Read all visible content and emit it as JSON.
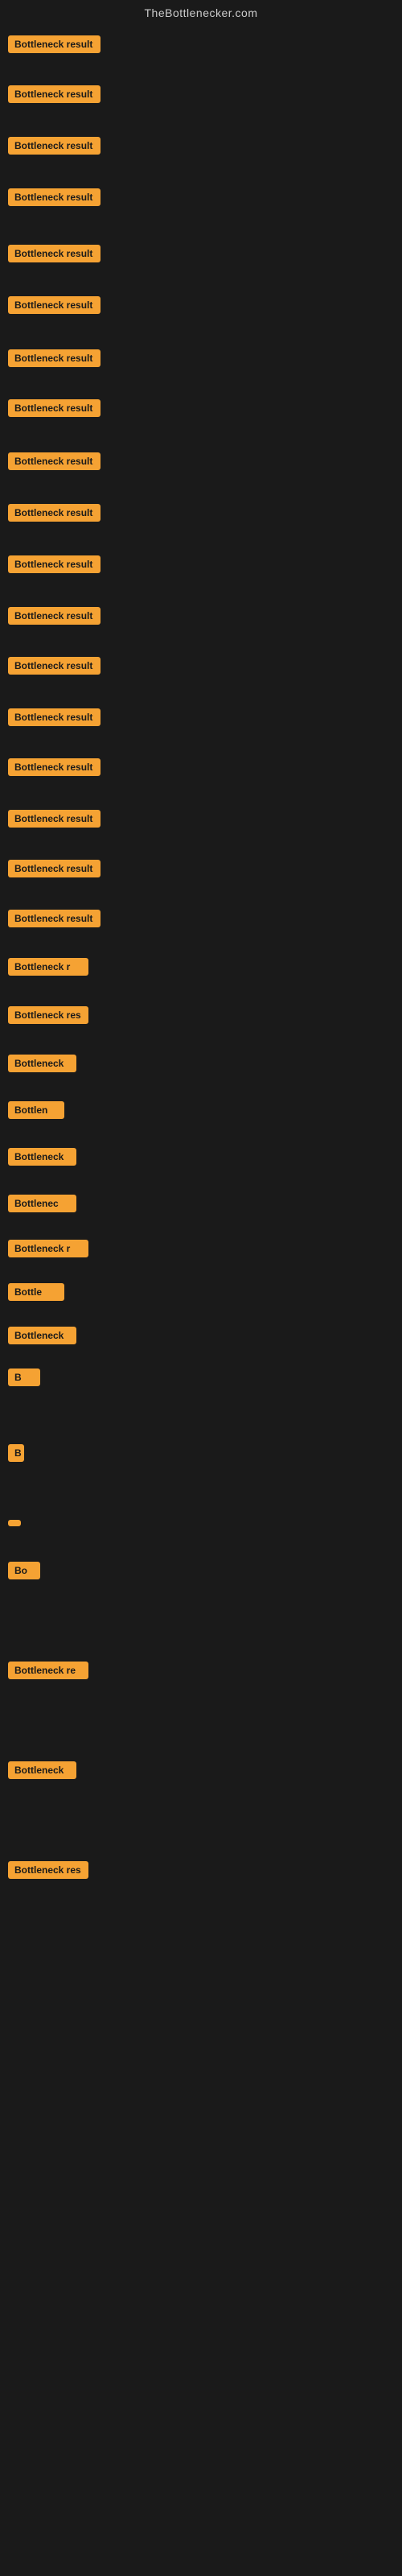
{
  "header": {
    "title": "TheBottlenecker.com"
  },
  "rows": [
    {
      "id": 1,
      "label": "Bottleneck result",
      "rowClass": "row-1",
      "badgeClass": "w-full"
    },
    {
      "id": 2,
      "label": "Bottleneck result",
      "rowClass": "row-2",
      "badgeClass": "w-full"
    },
    {
      "id": 3,
      "label": "Bottleneck result",
      "rowClass": "row-3",
      "badgeClass": "w-full"
    },
    {
      "id": 4,
      "label": "Bottleneck result",
      "rowClass": "row-4",
      "badgeClass": "w-full"
    },
    {
      "id": 5,
      "label": "Bottleneck result",
      "rowClass": "row-5",
      "badgeClass": "w-full"
    },
    {
      "id": 6,
      "label": "Bottleneck result",
      "rowClass": "row-6",
      "badgeClass": "w-full"
    },
    {
      "id": 7,
      "label": "Bottleneck result",
      "rowClass": "row-7",
      "badgeClass": "w-full"
    },
    {
      "id": 8,
      "label": "Bottleneck result",
      "rowClass": "row-8",
      "badgeClass": "w-full"
    },
    {
      "id": 9,
      "label": "Bottleneck result",
      "rowClass": "row-9",
      "badgeClass": "w-full"
    },
    {
      "id": 10,
      "label": "Bottleneck result",
      "rowClass": "row-10",
      "badgeClass": "w-full"
    },
    {
      "id": 11,
      "label": "Bottleneck result",
      "rowClass": "row-11",
      "badgeClass": "w-full"
    },
    {
      "id": 12,
      "label": "Bottleneck result",
      "rowClass": "row-12",
      "badgeClass": "w-full"
    },
    {
      "id": 13,
      "label": "Bottleneck result",
      "rowClass": "row-13",
      "badgeClass": "w-full"
    },
    {
      "id": 14,
      "label": "Bottleneck result",
      "rowClass": "row-14",
      "badgeClass": "w-full"
    },
    {
      "id": 15,
      "label": "Bottleneck result",
      "rowClass": "row-15",
      "badgeClass": "w-full"
    },
    {
      "id": 16,
      "label": "Bottleneck result",
      "rowClass": "row-16",
      "badgeClass": "w-full"
    },
    {
      "id": 17,
      "label": "Bottleneck result",
      "rowClass": "row-17",
      "badgeClass": "w-full"
    },
    {
      "id": 18,
      "label": "Bottleneck result",
      "rowClass": "row-18",
      "badgeClass": "w-full"
    },
    {
      "id": 19,
      "label": "Bottleneck r",
      "rowClass": "row-19",
      "badgeClass": "w-lg"
    },
    {
      "id": 20,
      "label": "Bottleneck res",
      "rowClass": "row-20",
      "badgeClass": "w-lg"
    },
    {
      "id": 21,
      "label": "Bottleneck",
      "rowClass": "row-21",
      "badgeClass": "w-md"
    },
    {
      "id": 22,
      "label": "Bottlen",
      "rowClass": "row-22",
      "badgeClass": "w-sm"
    },
    {
      "id": 23,
      "label": "Bottleneck",
      "rowClass": "row-23",
      "badgeClass": "w-md"
    },
    {
      "id": 24,
      "label": "Bottlenec",
      "rowClass": "row-24",
      "badgeClass": "w-md"
    },
    {
      "id": 25,
      "label": "Bottleneck r",
      "rowClass": "row-25",
      "badgeClass": "w-lg"
    },
    {
      "id": 26,
      "label": "Bottle",
      "rowClass": "row-26",
      "badgeClass": "w-sm"
    },
    {
      "id": 27,
      "label": "Bottleneck",
      "rowClass": "row-27",
      "badgeClass": "w-md"
    },
    {
      "id": 28,
      "label": "B",
      "rowClass": "row-28",
      "badgeClass": "w-xxs"
    },
    {
      "id": 29,
      "label": "B",
      "rowClass": "row-29",
      "badgeClass": "w-tiny"
    },
    {
      "id": 30,
      "label": "",
      "rowClass": "row-30",
      "badgeClass": "w-min"
    },
    {
      "id": 31,
      "label": "Bo",
      "rowClass": "row-31",
      "badgeClass": "w-xxs"
    },
    {
      "id": 32,
      "label": "Bottleneck re",
      "rowClass": "row-32",
      "badgeClass": "w-lg"
    },
    {
      "id": 33,
      "label": "Bottleneck",
      "rowClass": "row-33",
      "badgeClass": "w-md"
    },
    {
      "id": 34,
      "label": "Bottleneck res",
      "rowClass": "row-34",
      "badgeClass": "w-lg"
    }
  ]
}
